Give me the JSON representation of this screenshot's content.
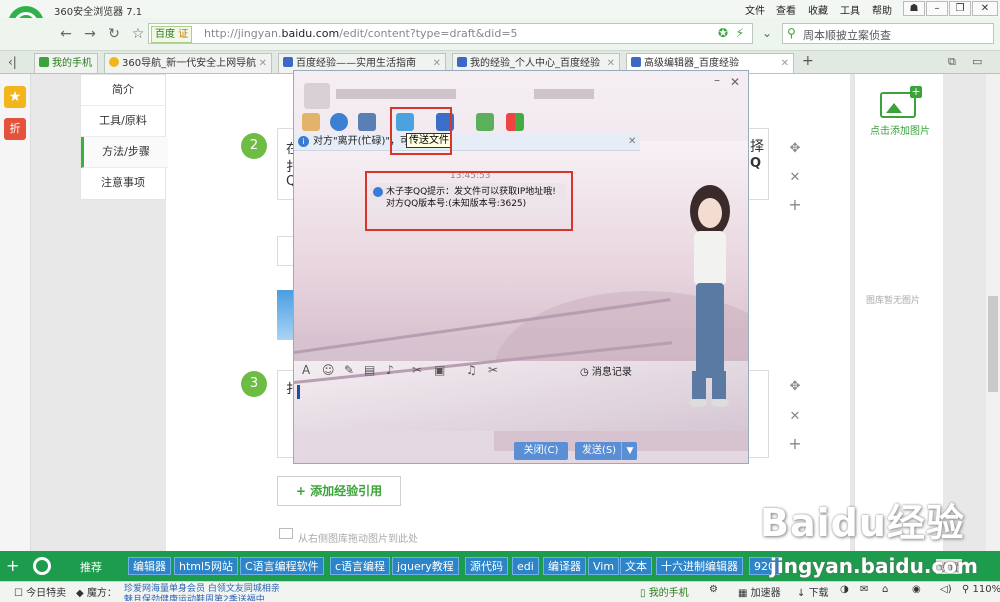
{
  "browser": {
    "title": "360安全浏览器 7.1",
    "menu": [
      "文件",
      "查看",
      "收藏",
      "工具",
      "帮助"
    ],
    "address": {
      "engine": "百度",
      "engine_badge": "证",
      "url_prefix": "http://jingyan.",
      "url_domain": "baidu.com",
      "url_rest": "/edit/content?type=draft&did=5"
    },
    "search_text": "周本顺披立案侦查",
    "tabs": [
      {
        "label": "我的手机"
      },
      {
        "label": "360导航_新一代安全上网导航"
      },
      {
        "label": "百度经验——实用生活指南"
      },
      {
        "label": "我的经验_个人中心_百度经验"
      },
      {
        "label": "高级编辑器_百度经验"
      }
    ]
  },
  "sidebar": {
    "items": [
      "简介",
      "工具/原料",
      "方法/步骤",
      "注意事项"
    ],
    "active": "方法/步骤",
    "red_label": "折"
  },
  "steps": [
    {
      "num": "2",
      "text_left": "在",
      "text_right": "择",
      "line2_left": "扌",
      "line2_right": "Q",
      "line3_left": "Q"
    },
    {
      "num": "3",
      "text_left": "扌"
    }
  ],
  "editor": {
    "add_ref": "+ 添加经验引用",
    "drag_hint": "从右侧图库拖动图片到此处",
    "right_panel": {
      "add_image": "点击添加图片",
      "no_image": "图库暂无图片"
    }
  },
  "qq": {
    "notice": "对方\"离开(忙碌)\"，可",
    "notice_tail": "回复",
    "tooltip": "传送文件",
    "time": "13:45:53",
    "msg_line1": "木子李QQ提示：发文件可以获取IP地址哦!",
    "msg_line2": "对方QQ版本号:(未知版本号:3625)",
    "history": "消息记录",
    "btn_close": "关闭(C)",
    "btn_send": "发送(S)"
  },
  "favorites": {
    "recommend": "推荐",
    "items": [
      "编辑器",
      "html5网站",
      "C语言编程软件",
      "c语言编程",
      "jquery教程",
      "源代码",
      "edi",
      "编译器",
      "Vim",
      "文本",
      "十六进制编辑器",
      "920"
    ],
    "settings": "设置"
  },
  "status": {
    "today": "今日特卖",
    "magic": "魔方：",
    "ticker1": "珍爱网海量单身会员 白领文友同城相亲",
    "ticker2": "魅且保劲健康运动鞋周第2季送福中",
    "phone": "我的手机",
    "accelerator": "加速器",
    "download": "下载",
    "zoom": "110%"
  },
  "watermark": "Baidu经验",
  "watermark_url": "jingyan.baidu.com",
  "colors": {
    "green": "#1d9c4e",
    "red_highlight": "#d9352b",
    "fav_blue": "#2d84c9"
  }
}
